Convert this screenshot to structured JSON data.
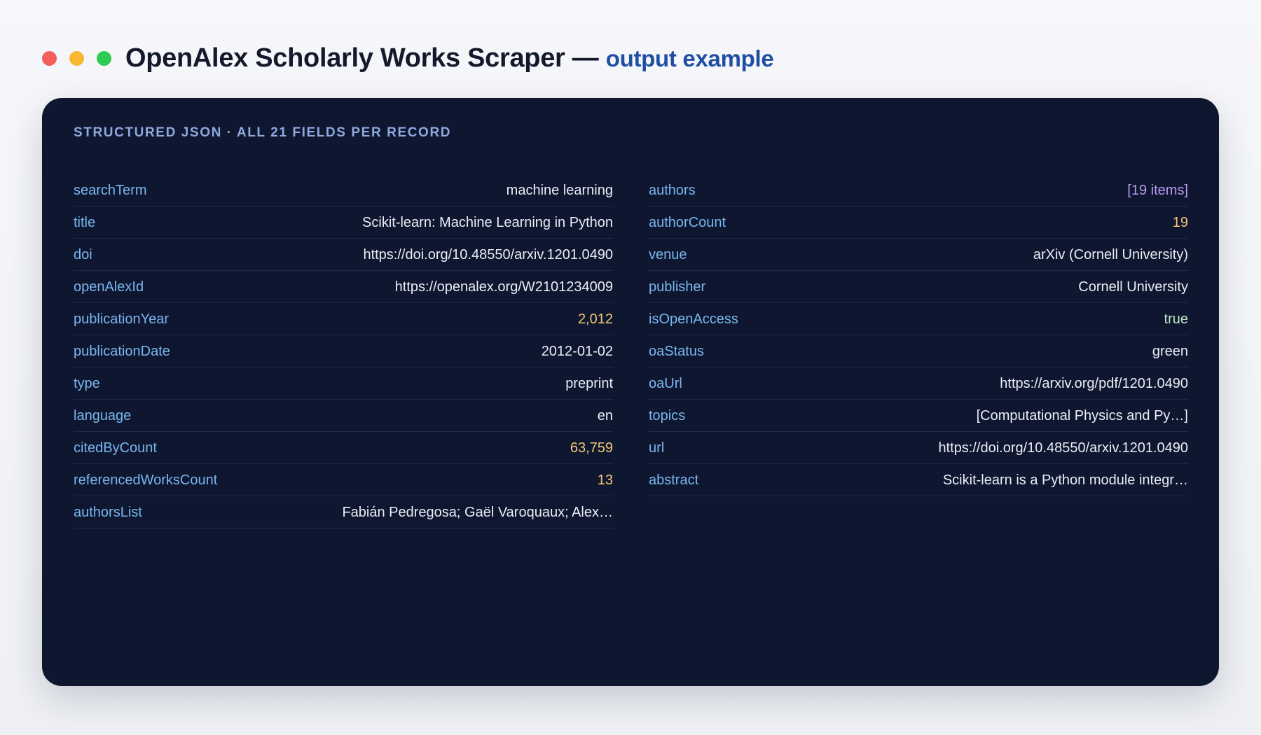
{
  "header": {
    "title": "OpenAlex Scholarly Works Scraper —",
    "subtitle": "output example"
  },
  "panel": {
    "label": "STRUCTURED JSON · ALL 21 FIELDS PER RECORD",
    "left": [
      {
        "key": "searchTerm",
        "value": "machine learning",
        "kind": "text"
      },
      {
        "key": "title",
        "value": "Scikit-learn: Machine Learning in Python",
        "kind": "text"
      },
      {
        "key": "doi",
        "value": "https://doi.org/10.48550/arxiv.1201.0490",
        "kind": "text"
      },
      {
        "key": "openAlexId",
        "value": "https://openalex.org/W2101234009",
        "kind": "text"
      },
      {
        "key": "publicationYear",
        "value": "2,012",
        "kind": "num"
      },
      {
        "key": "publicationDate",
        "value": "2012-01-02",
        "kind": "text"
      },
      {
        "key": "type",
        "value": "preprint",
        "kind": "text"
      },
      {
        "key": "language",
        "value": "en",
        "kind": "text"
      },
      {
        "key": "citedByCount",
        "value": "63,759",
        "kind": "num"
      },
      {
        "key": "referencedWorksCount",
        "value": "13",
        "kind": "num"
      },
      {
        "key": "authorsList",
        "value": "Fabián Pedregosa; Gaël Varoquaux; Alex…",
        "kind": "text"
      }
    ],
    "right": [
      {
        "key": "authors",
        "value": "[19 items]",
        "kind": "arr"
      },
      {
        "key": "authorCount",
        "value": "19",
        "kind": "num"
      },
      {
        "key": "venue",
        "value": "arXiv (Cornell University)",
        "kind": "text"
      },
      {
        "key": "publisher",
        "value": "Cornell University",
        "kind": "text"
      },
      {
        "key": "isOpenAccess",
        "value": "true",
        "kind": "bool"
      },
      {
        "key": "oaStatus",
        "value": "green",
        "kind": "text"
      },
      {
        "key": "oaUrl",
        "value": "https://arxiv.org/pdf/1201.0490",
        "kind": "text"
      },
      {
        "key": "topics",
        "value": "[Computational Physics and Py…]",
        "kind": "text"
      },
      {
        "key": "url",
        "value": "https://doi.org/10.48550/arxiv.1201.0490",
        "kind": "text"
      },
      {
        "key": "abstract",
        "value": "Scikit-learn is a Python module integr…",
        "kind": "text"
      }
    ]
  },
  "colors": {
    "panel_bg": "#0f1730",
    "key": "#79b6ee",
    "number": "#f1c874",
    "array": "#b89af0",
    "boolean": "#b9ecc4",
    "subtitle": "#1f4fa3"
  }
}
